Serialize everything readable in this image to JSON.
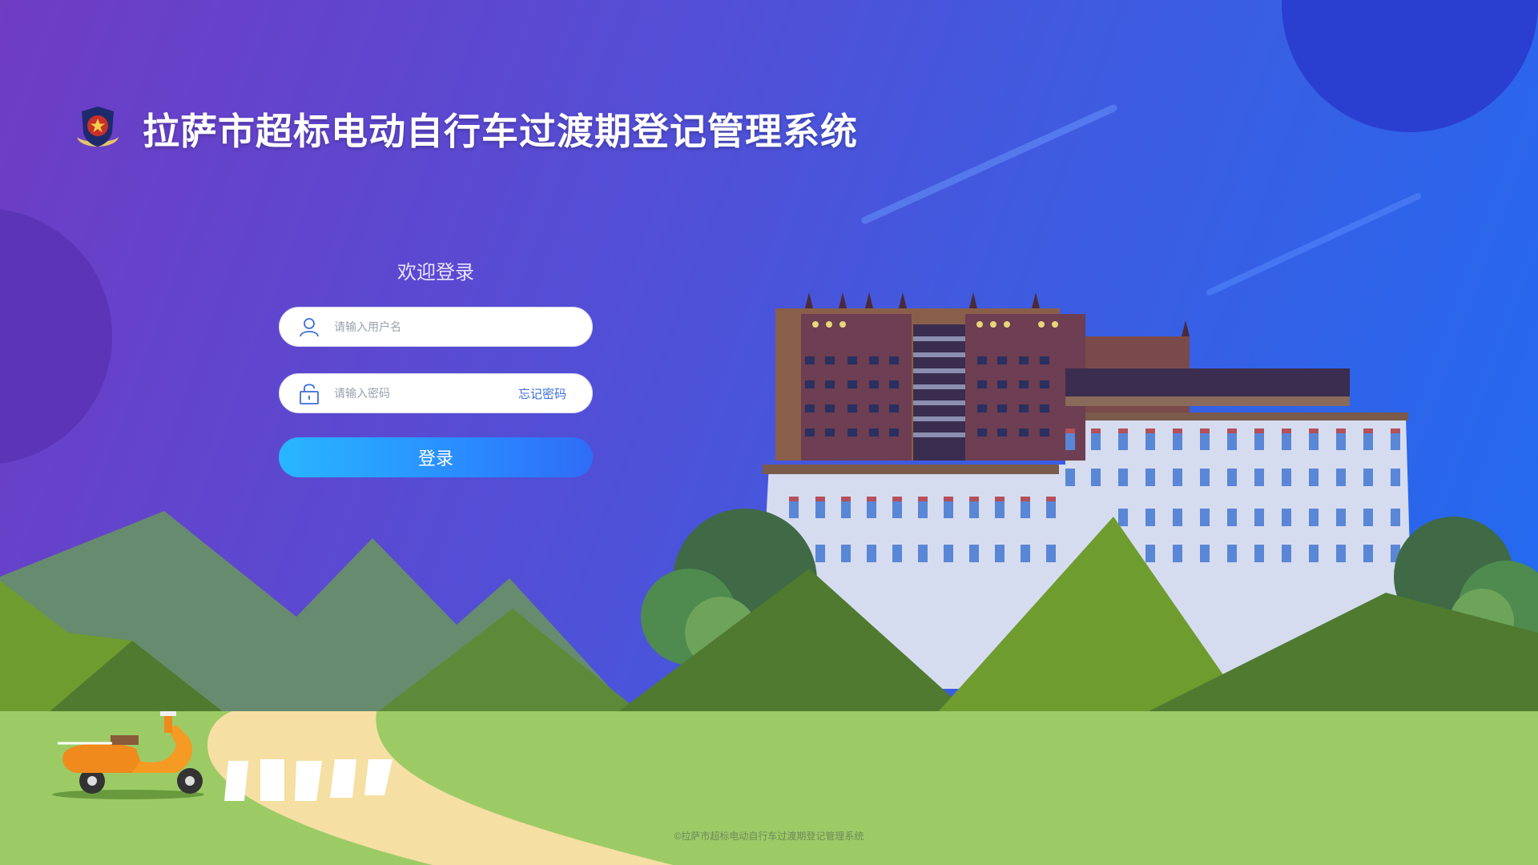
{
  "header": {
    "title": "拉萨市超标电动自行车过渡期登记管理系统",
    "emblem_icon": "police-emblem-icon"
  },
  "login": {
    "welcome": "欢迎登录",
    "username_placeholder": "请输入用户名",
    "password_placeholder": "请输入密码",
    "forgot_password": "忘记密码",
    "submit_label": "登录",
    "user_icon": "user-icon",
    "lock_icon": "lock-icon"
  },
  "footer": {
    "copyright": "©拉萨市超标电动自行车过渡期登记管理系统"
  },
  "colors": {
    "bg_start": "#6f3cc4",
    "bg_end": "#1f6cf2",
    "button_start": "#28b6ff",
    "button_end": "#2f6cf6",
    "grass": "#9ccb66"
  }
}
